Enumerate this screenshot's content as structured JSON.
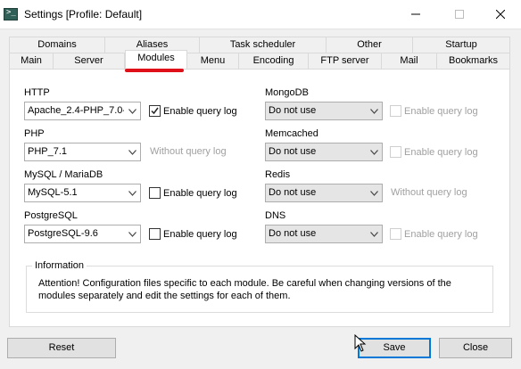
{
  "window": {
    "title": "Settings [Profile: Default]"
  },
  "tabs": {
    "back_row": [
      "Domains",
      "Aliases",
      "Task scheduler",
      "Other",
      "Startup"
    ],
    "front_row": [
      "Main",
      "Server",
      "Modules",
      "Menu",
      "Encoding",
      "FTP server",
      "Mail",
      "Bookmarks"
    ],
    "active": "Modules"
  },
  "modules": {
    "http": {
      "label": "HTTP",
      "value": "Apache_2.4-PHP_7.0-",
      "query_log_label": "Enable query log",
      "query_log_checked": true
    },
    "php": {
      "label": "PHP",
      "value": "PHP_7.1",
      "note": "Without query log"
    },
    "mysql": {
      "label": "MySQL / MariaDB",
      "value": "MySQL-5.1",
      "query_log_label": "Enable query log",
      "query_log_checked": false
    },
    "postgresql": {
      "label": "PostgreSQL",
      "value": "PostgreSQL-9.6",
      "query_log_label": "Enable query log",
      "query_log_checked": false
    },
    "mongodb": {
      "label": "MongoDB",
      "value": "Do not use",
      "query_log_label": "Enable query log",
      "disabled": true
    },
    "memcached": {
      "label": "Memcached",
      "value": "Do not use",
      "query_log_label": "Enable query log",
      "disabled": true
    },
    "redis": {
      "label": "Redis",
      "value": "Do not use",
      "note": "Without query log"
    },
    "dns": {
      "label": "DNS",
      "value": "Do not use",
      "query_log_label": "Enable query log",
      "disabled": true
    }
  },
  "information": {
    "title": "Information",
    "text": "Attention! Configuration files specific to each module. Be careful when changing versions of the modules separately and edit the settings for each of them."
  },
  "buttons": {
    "reset": "Reset",
    "save": "Save",
    "close": "Close"
  },
  "colors": {
    "active_tab_marker": "#e0101a",
    "focus_border": "#0078d7"
  }
}
